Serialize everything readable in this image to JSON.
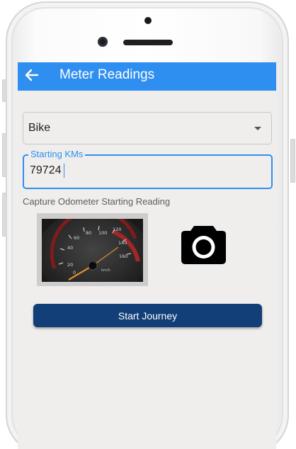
{
  "app_bar": {
    "title": "Meter Readings",
    "back_icon": "arrow-left-icon",
    "color": "#2f8ff0"
  },
  "vehicle_select": {
    "selected": "Bike",
    "icon": "caret-down-icon"
  },
  "starting_kms": {
    "label": "Starting KMs",
    "value": "79724",
    "accent": "#2f8ff0"
  },
  "capture": {
    "label": "Capture Odometer Starting Reading",
    "camera_icon": "camera-icon",
    "photo_icon": "speedometer-photo",
    "dial_labels": [
      "20",
      "40",
      "60",
      "80",
      "100",
      "120",
      "140",
      "160",
      "0"
    ],
    "dial_unit": "km/h"
  },
  "actions": {
    "start_label": "Start Journey",
    "start_color": "#123f78"
  }
}
